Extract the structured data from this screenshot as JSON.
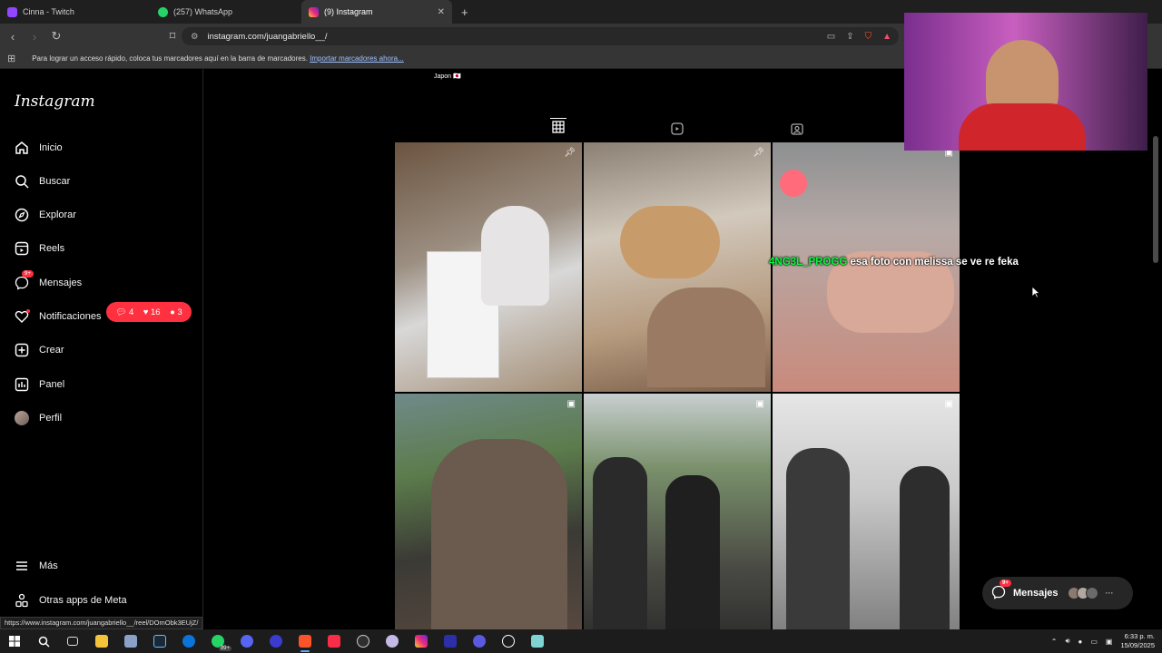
{
  "browser": {
    "tabs": [
      {
        "label": "Cinna - Twitch",
        "icon": "twitch-icon",
        "color": "#9146ff"
      },
      {
        "label": "(257) WhatsApp",
        "icon": "whatsapp-icon",
        "color": "#25d366"
      },
      {
        "label": "(9) Instagram",
        "icon": "instagram-icon",
        "color": "#e1306c"
      }
    ],
    "url": "instagram.com/juangabriello__/",
    "bookmarks_hint": "Para lograr un acceso rápido, coloca tus marcadores aquí en la barra de marcadores.",
    "bookmarks_link": "Importar marcadores ahora...",
    "status_url": "https://www.instagram.com/juangabriello__/reel/DOmObk3EUjZ/"
  },
  "sidebar": {
    "logo": "Instagram",
    "items": [
      {
        "label": "Inicio",
        "icon": "home-icon"
      },
      {
        "label": "Buscar",
        "icon": "search-icon"
      },
      {
        "label": "Explorar",
        "icon": "compass-icon"
      },
      {
        "label": "Reels",
        "icon": "reels-icon"
      },
      {
        "label": "Mensajes",
        "icon": "messenger-icon",
        "badge": "9+"
      },
      {
        "label": "Notificaciones",
        "icon": "heart-icon"
      },
      {
        "label": "Crear",
        "icon": "plus-square-icon"
      },
      {
        "label": "Panel",
        "icon": "chart-icon"
      },
      {
        "label": "Perfil",
        "icon": "avatar"
      }
    ],
    "more": "Más",
    "meta": "Otras apps de Meta",
    "notifications_pill": {
      "comments": "4",
      "likes": "16",
      "follows": "3"
    }
  },
  "profile": {
    "bio_line": "Japon 🇯🇵"
  },
  "overlay": {
    "chat_user": "4NG3L_PROGG",
    "chat_text": "esa foto con melissa se ve re feka"
  },
  "messages_button": {
    "label": "Mensajes",
    "badge": "9+"
  },
  "taskbar": {
    "time": "6:33 p. m.",
    "date": "15/09/2025",
    "whatsapp_badge": "99+"
  },
  "colors": {
    "accent": "#ff3040",
    "background": "#000000",
    "chat_user": "#00ff3b"
  }
}
